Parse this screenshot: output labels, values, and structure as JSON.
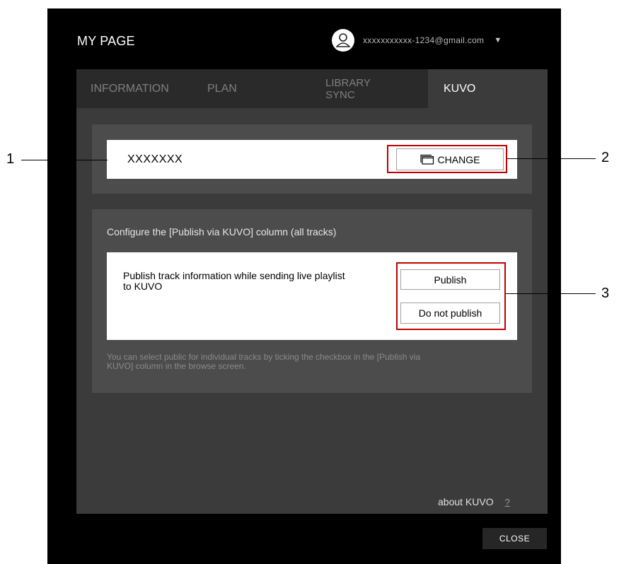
{
  "window": {
    "title": "MY PAGE"
  },
  "account": {
    "email": "xxxxxxxxxxx-1234@gmail.com",
    "avatar_icon": "user-icon",
    "menu_icon": "chevron-down-icon"
  },
  "tabs": [
    {
      "label": "INFORMATION",
      "active": false
    },
    {
      "label": "PLAN",
      "active": false
    },
    {
      "label": "LIBRARY SYNC",
      "line1": "LIBRARY",
      "line2": "SYNC",
      "active": false
    },
    {
      "label": "KUVO",
      "active": true
    }
  ],
  "kuvo_account": {
    "name": "XXXXXXX",
    "change_label": "CHANGE",
    "change_icon": "window-icon"
  },
  "publish": {
    "heading": "Configure the [Publish via KUVO] column (all tracks)",
    "description": "Publish track information while sending live playlist to KUVO",
    "publish_label": "Publish",
    "do_not_publish_label": "Do not publish",
    "note": "You can select public for individual tracks by ticking the checkbox in the [Publish via KUVO] column in the browse screen."
  },
  "footer": {
    "about_label": "about KUVO",
    "help_symbol": "?",
    "close_label": "CLOSE"
  },
  "callouts": [
    "1",
    "2",
    "3"
  ],
  "colors": {
    "highlight": "#c00000",
    "window_bg": "#000000",
    "tab_bar": "#2a2a2a",
    "content_bg": "#3b3b3b",
    "panel_bg": "#4c4c4c"
  }
}
